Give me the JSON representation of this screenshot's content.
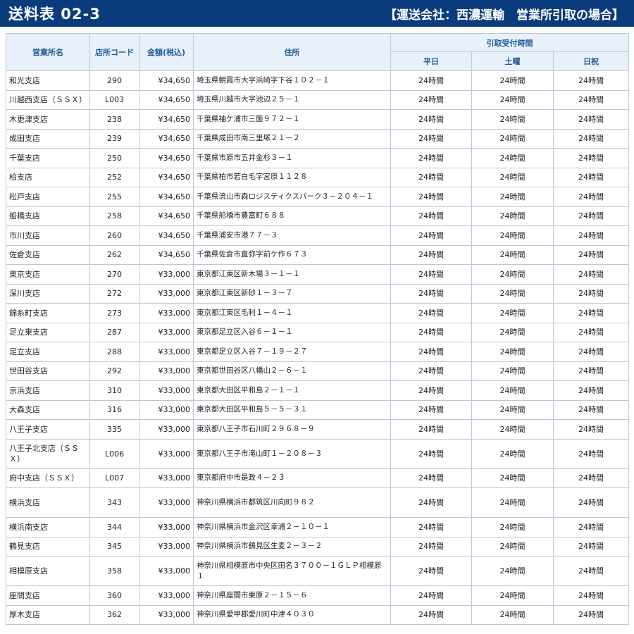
{
  "header": {
    "title": "送料表 02-3",
    "subtitle": "【運送会社：西濃運輸　営業所引取の場合】"
  },
  "table": {
    "columns": {
      "name": "営業所名",
      "code": "店所コード",
      "price": "金額(税込)",
      "address": "住所",
      "pickup_group": "引取受付時間",
      "weekday": "平日",
      "saturday": "土曜",
      "holiday": "日祝"
    },
    "rows": [
      {
        "name": "和光支店",
        "code": "290",
        "price": "¥34,650",
        "address": "埼玉県朝霞市大字浜崎字下谷１０２－１",
        "weekday": "24時間",
        "saturday": "24時間",
        "holiday": "24時間"
      },
      {
        "name": "川越西支店（ＳＳＸ）",
        "code": "L003",
        "price": "¥34,650",
        "address": "埼玉県川越市大字池辺２５－１",
        "weekday": "24時間",
        "saturday": "24時間",
        "holiday": "24時間"
      },
      {
        "name": "木更津支店",
        "code": "238",
        "price": "¥34,650",
        "address": "千葉県袖ケ浦市三箇９７２－１",
        "weekday": "24時間",
        "saturday": "24時間",
        "holiday": "24時間"
      },
      {
        "name": "成田支店",
        "code": "239",
        "price": "¥34,650",
        "address": "千葉県成田市南三里塚２１－２",
        "weekday": "24時間",
        "saturday": "24時間",
        "holiday": "24時間"
      },
      {
        "name": "千葉支店",
        "code": "250",
        "price": "¥34,650",
        "address": "千葉県市原市五井金杉３－１",
        "weekday": "24時間",
        "saturday": "24時間",
        "holiday": "24時間"
      },
      {
        "name": "柏支店",
        "code": "252",
        "price": "¥34,650",
        "address": "千葉県柏市若白毛字宮原１１２８",
        "weekday": "24時間",
        "saturday": "24時間",
        "holiday": "24時間"
      },
      {
        "name": "松戸支店",
        "code": "255",
        "price": "¥34,650",
        "address": "千葉県流山市森ロジスティクスパーク３－２０４－１",
        "weekday": "24時間",
        "saturday": "24時間",
        "holiday": "24時間"
      },
      {
        "name": "船橋支店",
        "code": "258",
        "price": "¥34,650",
        "address": "千葉県船橋市豊富町６８８",
        "weekday": "24時間",
        "saturday": "24時間",
        "holiday": "24時間"
      },
      {
        "name": "市川支店",
        "code": "260",
        "price": "¥34,650",
        "address": "千葉県浦安市港７７－３",
        "weekday": "24時間",
        "saturday": "24時間",
        "holiday": "24時間"
      },
      {
        "name": "佐倉支店",
        "code": "262",
        "price": "¥34,650",
        "address": "千葉県佐倉市直弥字前ケ作６７３",
        "weekday": "24時間",
        "saturday": "24時間",
        "holiday": "24時間"
      },
      {
        "name": "東京支店",
        "code": "270",
        "price": "¥33,000",
        "address": "東京都江東区新木場３－１－１",
        "weekday": "24時間",
        "saturday": "24時間",
        "holiday": "24時間"
      },
      {
        "name": "深川支店",
        "code": "272",
        "price": "¥33,000",
        "address": "東京都江東区新砂１－３－７",
        "weekday": "24時間",
        "saturday": "24時間",
        "holiday": "24時間"
      },
      {
        "name": "錦糸町支店",
        "code": "273",
        "price": "¥33,000",
        "address": "東京都江東区毛利１－４－１",
        "weekday": "24時間",
        "saturday": "24時間",
        "holiday": "24時間"
      },
      {
        "name": "足立東支店",
        "code": "287",
        "price": "¥33,000",
        "address": "東京都足立区入谷６－１－１",
        "weekday": "24時間",
        "saturday": "24時間",
        "holiday": "24時間"
      },
      {
        "name": "足立支店",
        "code": "288",
        "price": "¥33,000",
        "address": "東京都足立区入谷７－１９－２７",
        "weekday": "24時間",
        "saturday": "24時間",
        "holiday": "24時間"
      },
      {
        "name": "世田谷支店",
        "code": "292",
        "price": "¥33,000",
        "address": "東京都世田谷区八幡山２－６－１",
        "weekday": "24時間",
        "saturday": "24時間",
        "holiday": "24時間"
      },
      {
        "name": "京浜支店",
        "code": "310",
        "price": "¥33,000",
        "address": "東京都大田区平和島２－１－１",
        "weekday": "24時間",
        "saturday": "24時間",
        "holiday": "24時間"
      },
      {
        "name": "大森支店",
        "code": "316",
        "price": "¥33,000",
        "address": "東京都大田区平和島５－５－３１",
        "weekday": "24時間",
        "saturday": "24時間",
        "holiday": "24時間"
      },
      {
        "name": "八王子支店",
        "code": "335",
        "price": "¥33,000",
        "address": "東京都八王子市石川町２９６８－９",
        "weekday": "24時間",
        "saturday": "24時間",
        "holiday": "24時間"
      },
      {
        "name": "八王子北支店（ＳＳＸ）",
        "code": "L006",
        "price": "¥33,000",
        "address": "東京都八王子市滝山町１－２０８－３",
        "weekday": "24時間",
        "saturday": "24時間",
        "holiday": "24時間",
        "tall": true
      },
      {
        "name": "府中支店（ＳＳＸ）",
        "code": "L007",
        "price": "¥33,000",
        "address": "東京都府中市是政４－２３",
        "weekday": "24時間",
        "saturday": "24時間",
        "holiday": "24時間"
      },
      {
        "name": "横浜支店",
        "code": "343",
        "price": "¥33,000",
        "address": "神奈川県横浜市都筑区川向町９８２",
        "weekday": "24時間",
        "saturday": "24時間",
        "holiday": "24時間",
        "tall": true
      },
      {
        "name": "横浜南支店",
        "code": "344",
        "price": "¥33,000",
        "address": "神奈川県横浜市金沢区幸浦２－１０－１",
        "weekday": "24時間",
        "saturday": "24時間",
        "holiday": "24時間"
      },
      {
        "name": "鶴見支店",
        "code": "345",
        "price": "¥33,000",
        "address": "神奈川県横浜市鶴見区生麦２－３－２",
        "weekday": "24時間",
        "saturday": "24時間",
        "holiday": "24時間"
      },
      {
        "name": "相模原支店",
        "code": "358",
        "price": "¥33,000",
        "address": "神奈川県相模原市中央区田名３７００－１ＧＬＰ相模原１",
        "weekday": "24時間",
        "saturday": "24時間",
        "holiday": "24時間",
        "tall": true
      },
      {
        "name": "座間支店",
        "code": "360",
        "price": "¥33,000",
        "address": "神奈川県座間市東原２－１５－６",
        "weekday": "24時間",
        "saturday": "24時間",
        "holiday": "24時間"
      },
      {
        "name": "厚木支店",
        "code": "362",
        "price": "¥33,000",
        "address": "神奈川県愛甲郡愛川町中津４０３０",
        "weekday": "24時間",
        "saturday": "24時間",
        "holiday": "24時間"
      }
    ]
  }
}
